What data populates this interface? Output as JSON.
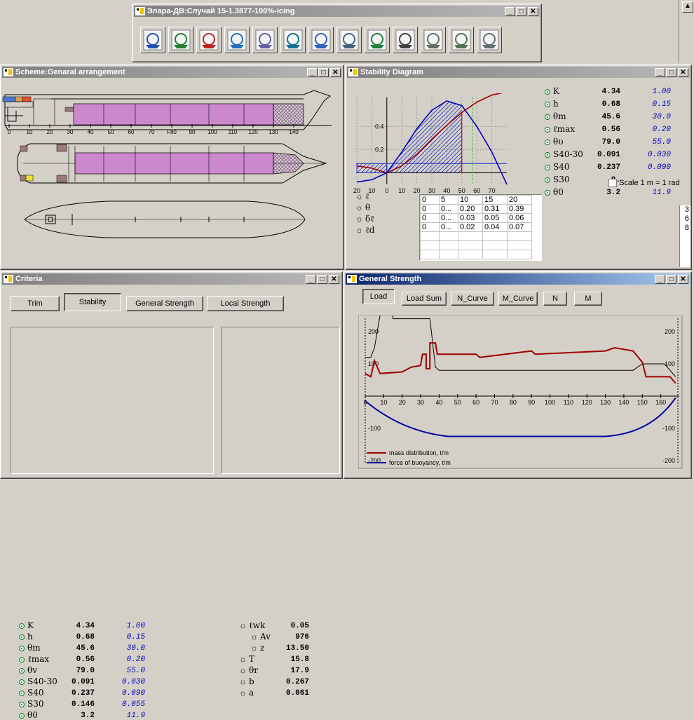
{
  "main_window": {
    "title": "Элара-ДВ:Случай 15-1.3877-100%-icing",
    "tools": [
      "ship-helm-icon",
      "lifebuoy-icon",
      "scales-icon",
      "globe-ship-icon",
      "sigma-icon",
      "ship-load-icon",
      "tanks-icon",
      "stability-curve-icon",
      "ship-wave-icon",
      "pd-icon",
      "ship-sinking-icon",
      "ship-grid-icon",
      "report-icon"
    ]
  },
  "scheme": {
    "title": "Scheme:Genaral arrangement",
    "frame_ticks": [
      "0",
      "10",
      "20",
      "30",
      "40",
      "50",
      "60",
      "70",
      "F80",
      "90",
      "100",
      "110",
      "120",
      "130",
      "140"
    ]
  },
  "stability": {
    "title": "Stability Diagram",
    "chart_data": {
      "type": "line",
      "x": [
        -20,
        -10,
        0,
        10,
        20,
        30,
        40,
        50,
        60,
        70,
        80
      ],
      "series": [
        {
          "name": "",
          "color": "#a00000",
          "values": [
            0.06,
            0.04,
            0.0,
            0.06,
            0.16,
            0.29,
            0.41,
            0.52,
            0.61,
            0.67,
            0.7
          ]
        },
        {
          "name": "",
          "color": "#0000c0",
          "values": [
            -0.08,
            -0.06,
            0.0,
            0.18,
            0.38,
            0.54,
            0.62,
            0.58,
            0.4,
            0.18,
            -0.1
          ]
        }
      ],
      "xticks": [
        "20",
        "10",
        "0",
        "10",
        "20",
        "30",
        "40",
        "50",
        "60",
        "70"
      ],
      "yticks": [
        "0.4",
        "0.2"
      ],
      "xlim": [
        -20,
        80
      ],
      "ylim": [
        -0.1,
        0.65
      ]
    },
    "params": [
      {
        "sym": "K",
        "val": "4.34",
        "req": "1.00"
      },
      {
        "sym": "h",
        "val": "0.68",
        "req": "0.15"
      },
      {
        "sym": "θm",
        "val": "45.6",
        "req": "30.0"
      },
      {
        "sym": "ℓmax",
        "val": "0.56",
        "req": "0.20"
      },
      {
        "sym": "θυ",
        "val": "79.0",
        "req": "55.0"
      },
      {
        "sym": "S40-30",
        "val": "0.091",
        "req": "0.030"
      },
      {
        "sym": "S40",
        "val": "0.237",
        "req": "0.090"
      },
      {
        "sym": "S30",
        "val": "0.",
        "req": ""
      },
      {
        "sym": "θ0",
        "val": "3.2",
        "req": "11.9"
      }
    ],
    "scale_label": "Scale 1 m = 1 rad",
    "legend": [
      "ℓ",
      "θ",
      "δℓ",
      "ℓd"
    ],
    "table_header": [
      "0",
      "5",
      "10",
      "15",
      "20"
    ],
    "table_rows": [
      [
        "0",
        "0...",
        "0.20",
        "0.31",
        "0.39"
      ],
      [
        "0",
        "0...",
        "0.03",
        "0.05",
        "0.06"
      ],
      [
        "0",
        "0...",
        "0.02",
        "0.04",
        "0.07"
      ]
    ],
    "right_clip": [
      "3",
      "6",
      "8"
    ]
  },
  "criteria": {
    "title": "Criteria",
    "tabs": [
      "Trim",
      "Stability",
      "General Strength",
      "Local Strength"
    ],
    "params": [
      {
        "sym": "K",
        "val": "4.34",
        "req": "1.00"
      },
      {
        "sym": "h",
        "val": "0.68",
        "req": "0.15"
      },
      {
        "sym": "θm",
        "val": "45.6",
        "req": "30.0"
      },
      {
        "sym": "ℓmax",
        "val": "0.56",
        "req": "0.20"
      },
      {
        "sym": "θv",
        "val": "79.0",
        "req": "55.0"
      },
      {
        "sym": "S40-30",
        "val": "0.091",
        "req": "0.030"
      },
      {
        "sym": "S40",
        "val": "0.237",
        "req": "0.090"
      },
      {
        "sym": "S30",
        "val": "0.146",
        "req": "0.055"
      },
      {
        "sym": "θ0",
        "val": "3.2",
        "req": "11.9"
      }
    ],
    "extra": [
      {
        "sym": "ℓwk",
        "val": "0.05"
      },
      {
        "sym": "Av",
        "val": "976"
      },
      {
        "sym": "z",
        "val": "13.50"
      },
      {
        "sym": "T",
        "val": "15.8"
      },
      {
        "sym": "θr",
        "val": "17.9"
      },
      {
        "sym": "b",
        "val": "0.267"
      },
      {
        "sym": "a",
        "val": "0.061"
      }
    ]
  },
  "strength": {
    "title": "General Strength",
    "buttons": [
      "Load",
      "Load Sum",
      "N_Curve",
      "M_Curve",
      "N",
      "M"
    ],
    "chart_data": {
      "type": "line",
      "x_ticks": [
        "0",
        "10",
        "20",
        "30",
        "40",
        "50",
        "60",
        "70",
        "80",
        "90",
        "100",
        "110",
        "120",
        "130",
        "140",
        "150",
        "160"
      ],
      "left_y_ticks": [
        "200",
        "100",
        "-100",
        "-200"
      ],
      "right_y_ticks": [
        "200",
        "100",
        "-100",
        "-200"
      ],
      "series": [
        {
          "name": "mass distribution, t/m",
          "color": "#a00000"
        },
        {
          "name": "force of buoyancy, t/m",
          "color": "#0000a0"
        }
      ]
    }
  },
  "colors": {
    "title_active": "#0a246a",
    "title_inactive": "#808080",
    "tank_pink": "#cc88cc",
    "hatch": "#9966aa",
    "red_curve": "#a00000",
    "blue_curve": "#0000c0"
  }
}
